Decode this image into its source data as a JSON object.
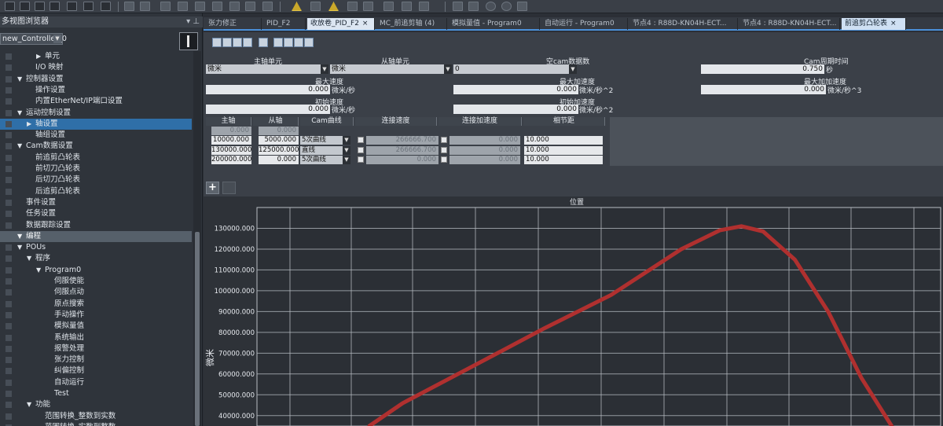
{
  "left_panel": {
    "header": "多视图浏览器",
    "controller_combo": "new_Controller_0",
    "tree": [
      {
        "label": "单元",
        "indent": 2,
        "arrow": "▶"
      },
      {
        "label": "I/O 映射",
        "indent": 1,
        "arrow": ""
      },
      {
        "label": "控制器设置",
        "indent": 0,
        "arrow": "▼"
      },
      {
        "label": "操作设置",
        "indent": 1,
        "arrow": ""
      },
      {
        "label": "内置EtherNet/IP端口设置",
        "indent": 1,
        "arrow": ""
      },
      {
        "label": "运动控制设置",
        "indent": 0,
        "arrow": "▼"
      },
      {
        "label": "轴设置",
        "indent": 1,
        "arrow": "▶"
      },
      {
        "label": "轴组设置",
        "indent": 1,
        "arrow": ""
      },
      {
        "label": "Cam数据设置",
        "indent": 0,
        "arrow": "▼"
      },
      {
        "label": "前追剪凸轮表",
        "indent": 1,
        "arrow": ""
      },
      {
        "label": "前切刀凸轮表",
        "indent": 1,
        "arrow": ""
      },
      {
        "label": "后切刀凸轮表",
        "indent": 1,
        "arrow": ""
      },
      {
        "label": "后追剪凸轮表",
        "indent": 1,
        "arrow": ""
      },
      {
        "label": "事件设置",
        "indent": 0,
        "arrow": ""
      },
      {
        "label": "任务设置",
        "indent": 0,
        "arrow": ""
      },
      {
        "label": "数据跟踪设置",
        "indent": 0,
        "arrow": ""
      },
      {
        "label": "编程",
        "indent": 0,
        "arrow": "▼"
      },
      {
        "label": "POUs",
        "indent": 0,
        "arrow": "▼"
      },
      {
        "label": "程序",
        "indent": 1,
        "arrow": "▼"
      },
      {
        "label": "Program0",
        "indent": 2,
        "arrow": "▼"
      },
      {
        "label": "伺服使能",
        "indent": 3,
        "arrow": ""
      },
      {
        "label": "伺服点动",
        "indent": 3,
        "arrow": ""
      },
      {
        "label": "原点搜索",
        "indent": 3,
        "arrow": ""
      },
      {
        "label": "手动操作",
        "indent": 3,
        "arrow": ""
      },
      {
        "label": "模拟量值",
        "indent": 3,
        "arrow": ""
      },
      {
        "label": "系统输出",
        "indent": 3,
        "arrow": ""
      },
      {
        "label": "报警处理",
        "indent": 3,
        "arrow": ""
      },
      {
        "label": "张力控制",
        "indent": 3,
        "arrow": ""
      },
      {
        "label": "纠偏控制",
        "indent": 3,
        "arrow": ""
      },
      {
        "label": "自动运行",
        "indent": 3,
        "arrow": ""
      },
      {
        "label": "Test",
        "indent": 3,
        "arrow": ""
      },
      {
        "label": "功能",
        "indent": 1,
        "arrow": "▼"
      },
      {
        "label": "范围转换_整数到实数",
        "indent": 2,
        "arrow": ""
      },
      {
        "label": "范围转换_实数到整数",
        "indent": 2,
        "arrow": ""
      }
    ]
  },
  "tabs": [
    "张力修正",
    "PID_F2",
    "收放卷_PID_F2",
    "MC_前追剪轴 (4)",
    "模拟量值 - Program0",
    "自动运行 - Program0",
    "节点4 : R88D-KN04H-ECT...",
    "节点4 : R88D-KN04H-ECT...",
    "前追剪凸轮表"
  ],
  "tab_close": "×",
  "cam": {
    "master_unit_label": "主轴单元",
    "master_unit_value": "微米",
    "slave_unit_label": "从轴单元",
    "slave_unit_value": "微米",
    "empty_cam_label": "空cam数据数",
    "empty_cam_value": "0",
    "cam_period_label": "Cam周期时间",
    "cam_period_value": "0.750",
    "cam_period_unit": "秒",
    "max_velocity_label": "最大速度",
    "max_velocity_value": "0.000",
    "max_velocity_unit": "微米/秒",
    "max_accel_label": "最大加速度",
    "max_accel_value": "0.000",
    "max_accel_unit": "微米/秒^2",
    "max_jerk_label": "最大加加速度",
    "max_jerk_value": "0.000",
    "max_jerk_unit": "微米/秒^3",
    "init_velocity_label": "初始速度",
    "init_velocity_value": "0.000",
    "init_velocity_unit": "微米/秒",
    "init_accel_label": "初始加速度",
    "init_accel_value": "0.000",
    "init_accel_unit": "微米/秒^2"
  },
  "table": {
    "headers": [
      "主轴",
      "从轴",
      "Cam曲线",
      "连接速度",
      "连接加速度",
      "相节距"
    ],
    "first_row": [
      "0.000",
      "0.000"
    ],
    "rows": [
      {
        "master": "10000.000",
        "slave": "5000.000",
        "curve": "5次曲线",
        "speed": "266666.700",
        "accel": "0.000",
        "pitch": "10.000"
      },
      {
        "master": "130000.000",
        "slave": "125000.000",
        "curve": "直线",
        "speed": "266666.700",
        "accel": "0.000",
        "pitch": "10.000"
      },
      {
        "master": "200000.000",
        "slave": "0.000",
        "curve": "5次曲线",
        "speed": "0.000",
        "accel": "0.000",
        "pitch": "10.000"
      }
    ],
    "add_button": "+"
  },
  "chart_data": {
    "type": "line",
    "title": "位置",
    "ylabel": "微米",
    "ylim": [
      35000,
      140000
    ],
    "yticks": [
      "130000.000",
      "120000.000",
      "110000.000",
      "100000.000",
      "90000.000",
      "80000.000",
      "70000.000",
      "60000.000",
      "50000.000",
      "40000.000"
    ],
    "series": [
      {
        "color": "#b0302f",
        "points": [
          [
            35,
            35000
          ],
          [
            55,
            46000
          ],
          [
            100,
            65000
          ],
          [
            140,
            82000
          ],
          [
            180,
            98000
          ],
          [
            222,
            120000
          ],
          [
            245,
            129000
          ],
          [
            258,
            131000
          ],
          [
            271,
            128500
          ],
          [
            290,
            115000
          ],
          [
            310,
            90000
          ],
          [
            330,
            58000
          ],
          [
            352,
            30000
          ]
        ]
      }
    ],
    "grid": true,
    "grid_color": "#b8bdc3"
  }
}
